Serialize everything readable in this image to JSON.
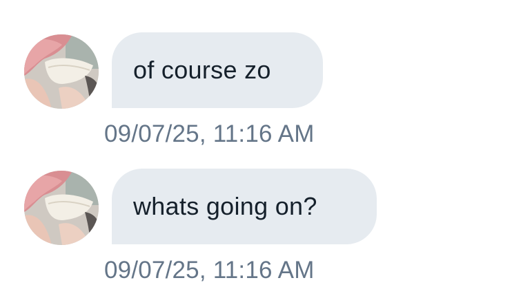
{
  "messages": [
    {
      "text": "of course zo",
      "timestamp": "09/07/25, 11:16 AM",
      "avatar_icon": "profile-avatar-pink-hair"
    },
    {
      "text": "whats going on?",
      "timestamp": "09/07/25, 11:16 AM",
      "avatar_icon": "profile-avatar-pink-hair"
    }
  ],
  "colors": {
    "bubble_background": "#e6ebf0",
    "message_text": "#15202b",
    "timestamp_text": "#647588",
    "page_background": "#ffffff"
  }
}
